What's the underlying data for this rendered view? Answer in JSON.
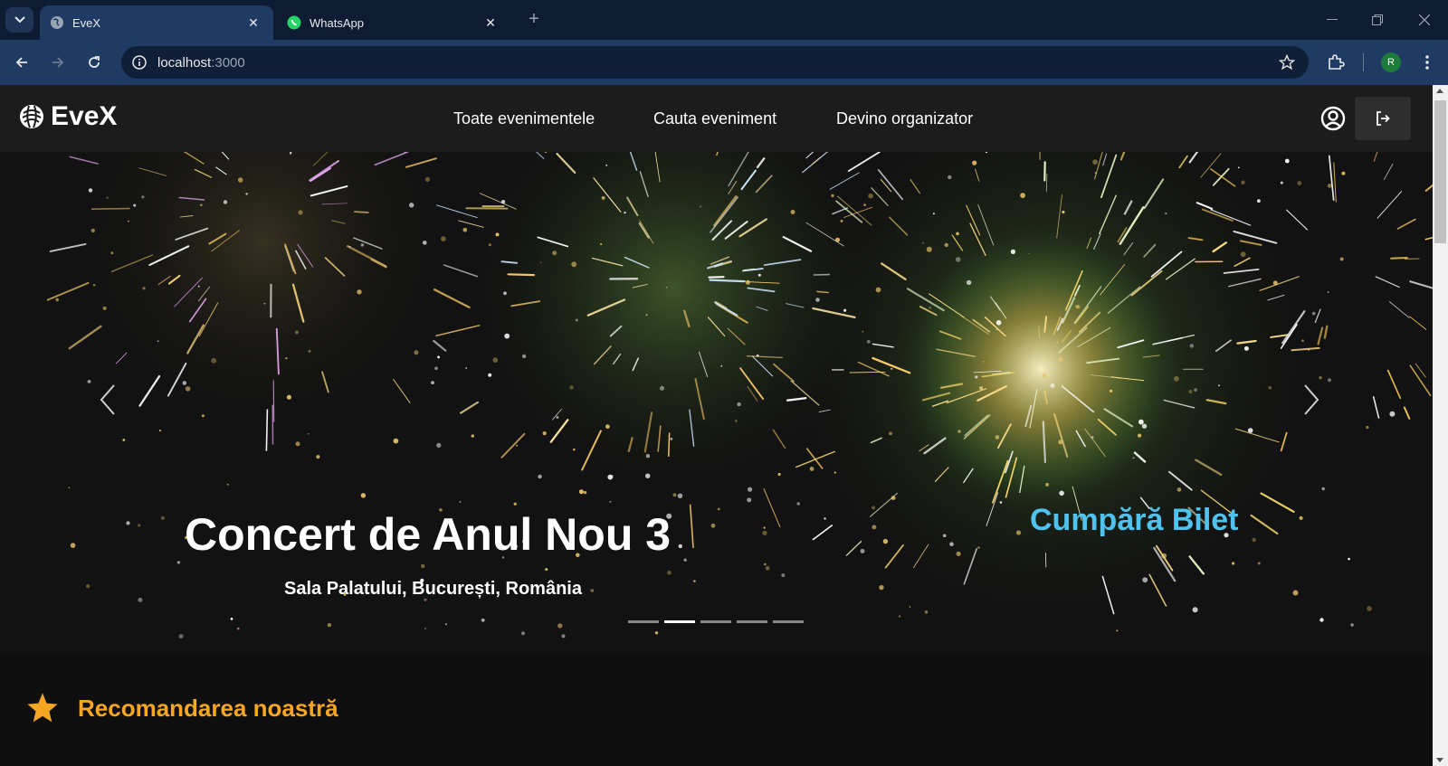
{
  "browser": {
    "tabs": [
      {
        "title": "EveX",
        "active": true,
        "icon": "globe-icon"
      },
      {
        "title": "WhatsApp",
        "active": false,
        "icon": "whatsapp-icon"
      }
    ],
    "url_host": "localhost",
    "url_port": ":3000",
    "profile_initial": "R",
    "colors": {
      "tabbar": "#0d1b33",
      "toolbar": "#1f3b63"
    }
  },
  "site": {
    "brand": "EveX",
    "nav": [
      {
        "label": "Toate evenimentele"
      },
      {
        "label": "Cauta eveniment"
      },
      {
        "label": "Devino organizator"
      }
    ],
    "colors": {
      "header": "#1c1c1c",
      "accent": "#f5a623",
      "buy": "#4fc3ee"
    }
  },
  "hero": {
    "title": "Concert de Anul Nou 3",
    "location": "Sala Palatului, București, România",
    "buy_label": "Cumpără Bilet",
    "slide_count": 5,
    "active_slide": 1
  },
  "recommendation": {
    "title": "Recomandarea noastră"
  }
}
